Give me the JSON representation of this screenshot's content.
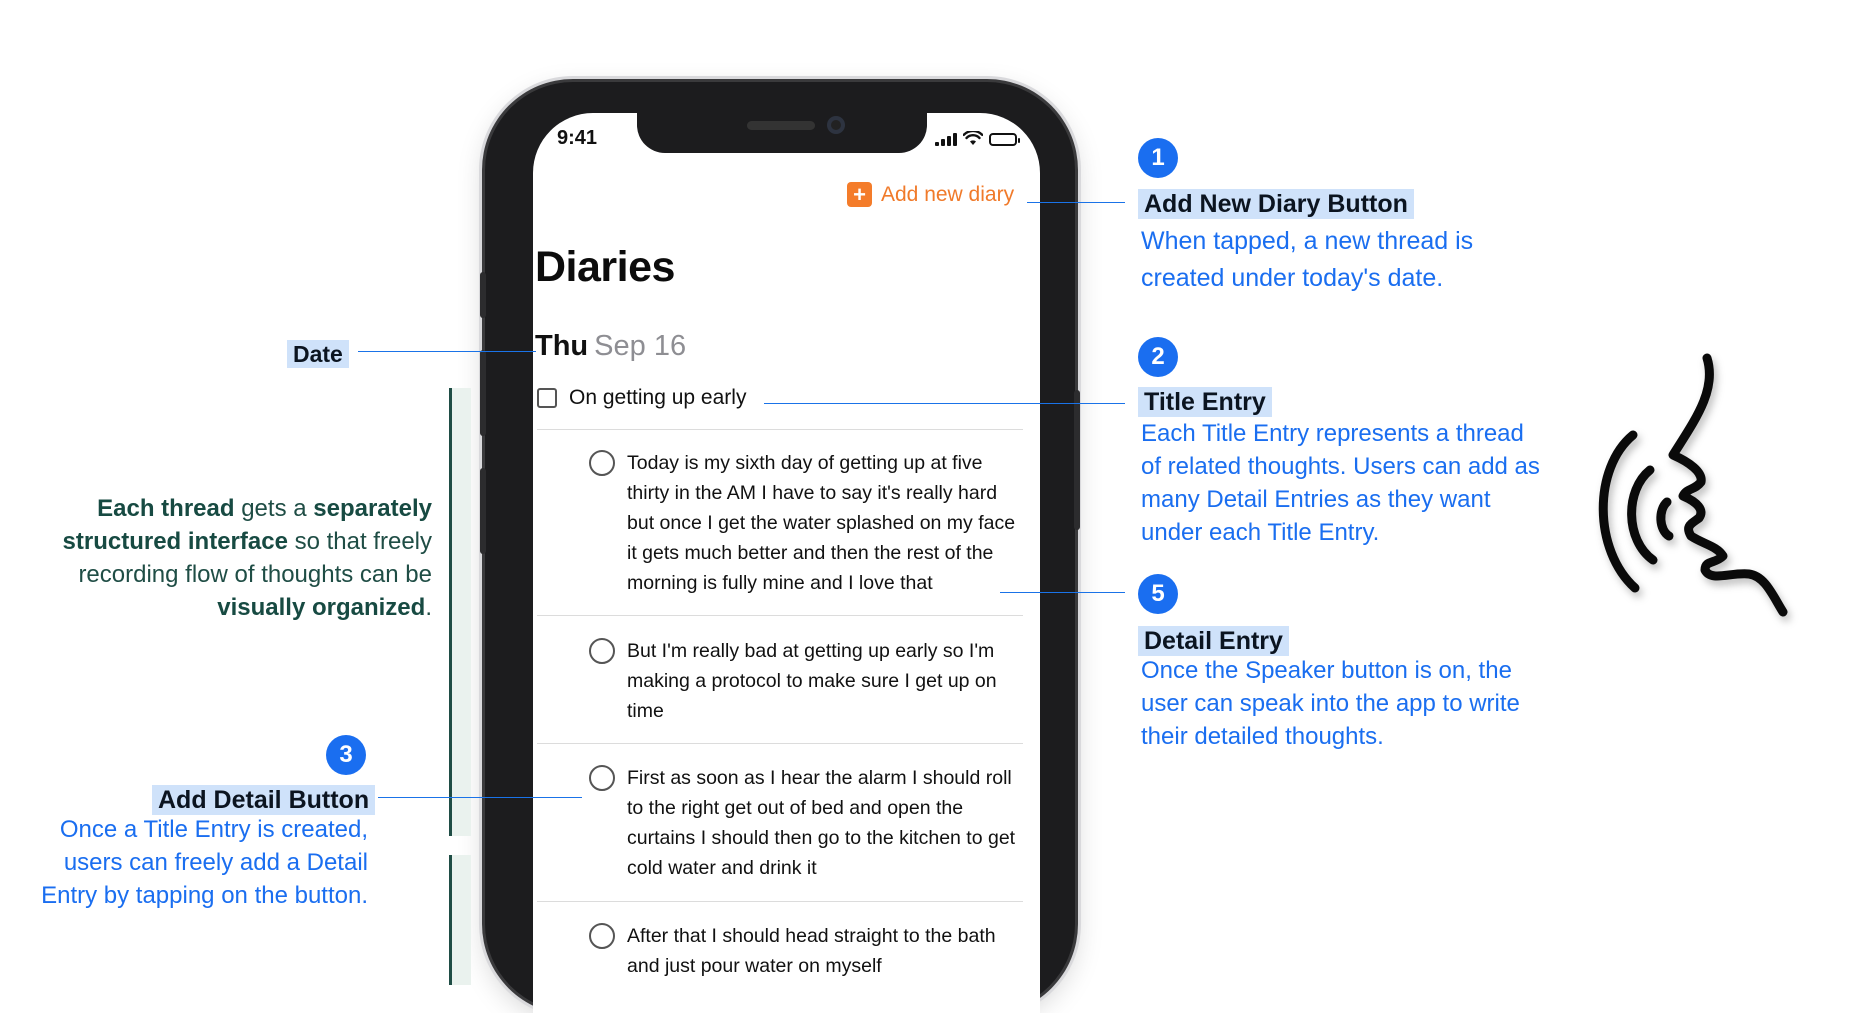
{
  "status_bar": {
    "time": "9:41"
  },
  "app": {
    "add_diary_icon": "+",
    "add_diary_label": "Add new diary",
    "title": "Diaries",
    "date_day": "Thu",
    "date_rest": "Sep 16",
    "title_entry": "On getting up early",
    "details": [
      "Today is my sixth day of getting up at five thirty in the AM I have to say it's really hard but once I get the water splashed on my face it gets much better and then the rest of the morning is fully mine and I love that",
      "But I'm really bad at getting up early so I'm making a protocol to make sure I get up on time",
      "First as soon as I hear the alarm I should roll to the right get out of bed and open the curtains I should then go to the kitchen to get cold water and drink it",
      "After that I should head straight to the bath and just pour water on myself"
    ]
  },
  "annotations": {
    "date_label": "Date",
    "thread_note": {
      "b1": "Each thread",
      "t1": " gets a ",
      "b2": "separately structured interface",
      "t2": " so that freely recording flow of thoughts can be ",
      "b3": "visually organized",
      "t3": "."
    },
    "items": [
      {
        "number": "1",
        "title": "Add New Diary Button",
        "body": "When tapped, a new thread is created under today's date."
      },
      {
        "number": "2",
        "title": "Title Entry",
        "body": "Each Title Entry represents a thread of related thoughts. Users can add as many Detail Entries as they want under each Title Entry."
      },
      {
        "number": "3",
        "title": "Add Detail Button",
        "body": "Once a Title Entry is created, users can freely add a Detail Entry by tapping on the button."
      },
      {
        "number": "5",
        "title": "Detail Entry",
        "body": "Once the Speaker button is on, the user can speak into the app to write their detailed thoughts."
      }
    ]
  },
  "icons": {
    "speaker_illustration": "speaking-person-icon",
    "accent_blue": "#1a6ef0",
    "accent_orange": "#f47c2a",
    "note_green": "#1f4d45"
  }
}
